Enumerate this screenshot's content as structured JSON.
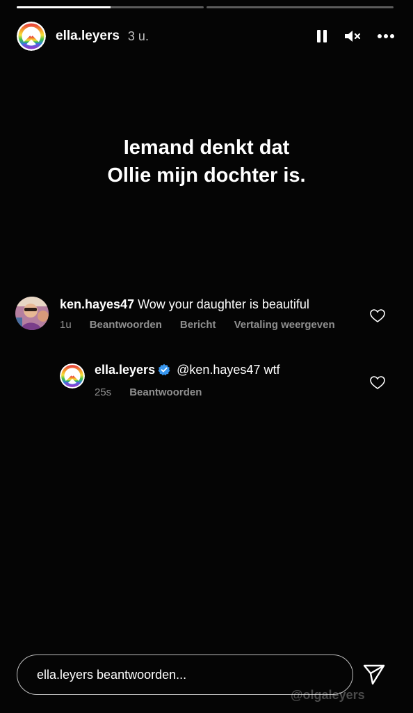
{
  "progress": [
    {
      "fill": 0.5
    },
    {
      "fill": 0.0
    }
  ],
  "header": {
    "username": "ella.leyers",
    "time": "3 u.",
    "icons": [
      "pause-icon",
      "mute-icon",
      "more-icon"
    ]
  },
  "story": {
    "line1": "Iemand denkt dat",
    "line2": "Ollie mijn dochter is."
  },
  "comments": [
    {
      "user": "ken.hayes47",
      "text": "Wow your daughter is beautiful",
      "time": "1u",
      "reply_label": "Beantwoorden",
      "message_label": "Bericht",
      "translate_label": "Vertaling weergeven"
    },
    {
      "user": "ella.leyers",
      "verified": true,
      "text": "@ken.hayes47 wtf",
      "time": "25s",
      "reply_label": "Beantwoorden"
    }
  ],
  "reply": {
    "placeholder": "ella.leyers beantwoorden..."
  },
  "watermark": "@olgaleyers",
  "colors": {
    "background": "#050505",
    "verified": "#3897f0"
  }
}
